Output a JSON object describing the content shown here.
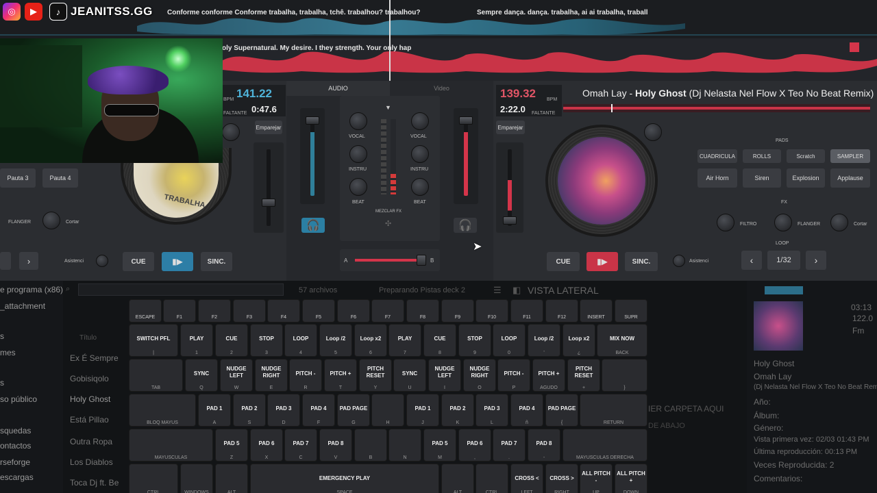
{
  "social": {
    "handle": "JEANITSS.GG",
    "instagram_icon": "instagram-icon",
    "youtube_icon": "youtube-icon",
    "tiktok_icon": "tiktok-icon"
  },
  "waveform": {
    "lyric_top_left": "Conforme conforme Conforme trabalha, trabalha, tchê. trabalhou? trabalhou?",
    "lyric_top_right": "Sempre dança. dança. trabalha, ai ai trabalha, traball",
    "lyric_bottom": "oly Supernatural. My desire.   I they strength.  Your only hap",
    "deck_a_color": "#2f7f9a",
    "deck_b_color": "#d4354a"
  },
  "deck_a": {
    "bpm": "141.22",
    "bpm_unit": "BPM",
    "remaining_label": "FALTANTE",
    "remaining": "0:47.6",
    "emparejar": "Emparejar",
    "pads": [
      "Pauta 3",
      "Pauta 4"
    ],
    "fx_labels": [
      "FLANGER",
      "Cortar"
    ],
    "cue": "CUE",
    "sinc": "SINC.",
    "asist": "Asistenci",
    "platter_text": "TRABALHA"
  },
  "mixer": {
    "tab_audio": "AUDIO",
    "tab_video": "Video",
    "left": [
      "VOCAL",
      "INSTRU",
      "BEAT"
    ],
    "right": [
      "VOCAL",
      "INSTRU",
      "BEAT"
    ],
    "mezclar": "MEZCLAR FX",
    "cross_a": "A",
    "cross_b": "B"
  },
  "deck_b": {
    "bpm": "139.32",
    "bpm_unit": "BPM",
    "remaining_label": "FALTANTE",
    "remaining": "2:22.0",
    "artist": "Omah Lay",
    "title": "Holy Ghost",
    "remix": "(Dj Nelasta Nel Flow X Teo No Beat Remix)",
    "emparejar": "Emparejar",
    "cue": "CUE",
    "sinc": "SINC.",
    "asist": "Asistenci",
    "pads_title": "PADS",
    "pad_modes": [
      "CUADRICULA",
      "ROLLS",
      "Scratch",
      "SAMPLER"
    ],
    "samples": [
      "Air Horn",
      "Siren",
      "Explosion",
      "Applause"
    ],
    "fx_title": "FX",
    "fx": [
      "FILTRO",
      "FLANGER",
      "Cortar"
    ],
    "loop_title": "LOOP",
    "loop_size": "1/32"
  },
  "browser": {
    "search_count": "57 archivos",
    "status": "Preparando Pistas deck 2",
    "vista_lateral": "VISTA LATERAL",
    "sidebar": [
      "e programa (x86)",
      "_attachment",
      "s",
      "mes",
      "s",
      "so público",
      "squedas",
      "ontactos",
      "rseforge",
      "escargas"
    ],
    "column_title": "Título",
    "tracks": [
      "Ex É Sempre",
      "Gobisiqolo",
      "Holy Ghost",
      "Está Pillao",
      "Outra Ropa",
      "Los Diablos",
      "Toca Dj ft. Be"
    ],
    "drop_hint": "IER CARPETA AQUI",
    "drop_sub": "DE ABAJO",
    "meta_time": "03:13",
    "meta_bpm": "122.0",
    "meta_key": "Fm",
    "meta_lines": [
      "Holy Ghost",
      "Omah Lay",
      "(Dj Nelasta Nel Flow X Teo No Beat Remi",
      "Año:",
      "Álbum:",
      "Género:",
      "Vista primera vez: 02/03 01:43 PM",
      "Última reproducción: 00:13 PM",
      "Veces Reproducida: 2",
      "Comentarios:"
    ]
  },
  "keyboard": {
    "row0": [
      [
        "ESCAPE",
        ""
      ],
      [
        "F1",
        ""
      ],
      [
        "F2",
        ""
      ],
      [
        "F3",
        ""
      ],
      [
        "F4",
        ""
      ],
      [
        "F5",
        ""
      ],
      [
        "F6",
        ""
      ],
      [
        "F7",
        ""
      ],
      [
        "F8",
        ""
      ],
      [
        "F9",
        ""
      ],
      [
        "F10",
        ""
      ],
      [
        "F11",
        ""
      ],
      [
        "F12",
        ""
      ],
      [
        "INSERT",
        ""
      ],
      [
        "SUPR",
        ""
      ]
    ],
    "row1": [
      [
        "SWITCH PFL",
        "|"
      ],
      [
        "PLAY",
        "1"
      ],
      [
        "CUE",
        "2"
      ],
      [
        "STOP",
        "3"
      ],
      [
        "LOOP",
        "4"
      ],
      [
        "Loop /2",
        "5"
      ],
      [
        "Loop x2",
        "6"
      ],
      [
        "PLAY",
        "7"
      ],
      [
        "CUE",
        "8"
      ],
      [
        "STOP",
        "9"
      ],
      [
        "LOOP",
        "0"
      ],
      [
        "Loop /2",
        "'"
      ],
      [
        "Loop x2",
        "¿"
      ],
      [
        "MIX NOW",
        "BACK"
      ]
    ],
    "row2": [
      [
        "",
        "TAB"
      ],
      [
        "SYNC",
        "Q"
      ],
      [
        "NUDGE LEFT",
        "W"
      ],
      [
        "NUDGE RIGHT",
        "E"
      ],
      [
        "PITCH -",
        "R"
      ],
      [
        "PITCH +",
        "T"
      ],
      [
        "PITCH RESET",
        "Y"
      ],
      [
        "SYNC",
        "U"
      ],
      [
        "NUDGE LEFT",
        "I"
      ],
      [
        "NUDGE RIGHT",
        "O"
      ],
      [
        "PITCH -",
        "P"
      ],
      [
        "PITCH +",
        "AGUDO"
      ],
      [
        "PITCH RESET",
        "+"
      ],
      [
        "",
        "}"
      ]
    ],
    "row3": [
      [
        "",
        "BLOQ MAYUS"
      ],
      [
        "PAD 1",
        "A"
      ],
      [
        "PAD 2",
        "S"
      ],
      [
        "PAD 3",
        "D"
      ],
      [
        "PAD 4",
        "F"
      ],
      [
        "PAD PAGE",
        "G"
      ],
      [
        "",
        "H"
      ],
      [
        "PAD 1",
        "J"
      ],
      [
        "PAD 2",
        "K"
      ],
      [
        "PAD 3",
        "L"
      ],
      [
        "PAD 4",
        "ñ"
      ],
      [
        "PAD PAGE",
        "{"
      ],
      [
        "",
        "RETURN"
      ]
    ],
    "row4": [
      [
        "",
        "MAYUSCULAS"
      ],
      [
        "PAD 5",
        "Z"
      ],
      [
        "PAD 6",
        "X"
      ],
      [
        "PAD 7",
        "C"
      ],
      [
        "PAD 8",
        "V"
      ],
      [
        "",
        "B"
      ],
      [
        "",
        "N"
      ],
      [
        "PAD 5",
        "M"
      ],
      [
        "PAD 6",
        ","
      ],
      [
        "PAD 7",
        "."
      ],
      [
        "PAD 8",
        "-"
      ],
      [
        "",
        "MAYUSCULAS DERECHA"
      ]
    ],
    "row5": [
      [
        "",
        "CTRL"
      ],
      [
        "",
        "WINDOWS"
      ],
      [
        "",
        "ALT"
      ],
      [
        "EMERGENCY PLAY",
        "SPACE"
      ],
      [
        "",
        "ALT"
      ],
      [
        "",
        "CTRL"
      ],
      [
        "CROSS <",
        "LEFT"
      ],
      [
        "CROSS >",
        "RIGHT"
      ],
      [
        "ALL PITCH -",
        "UP"
      ],
      [
        "ALL PITCH +",
        "DOWN"
      ]
    ]
  }
}
